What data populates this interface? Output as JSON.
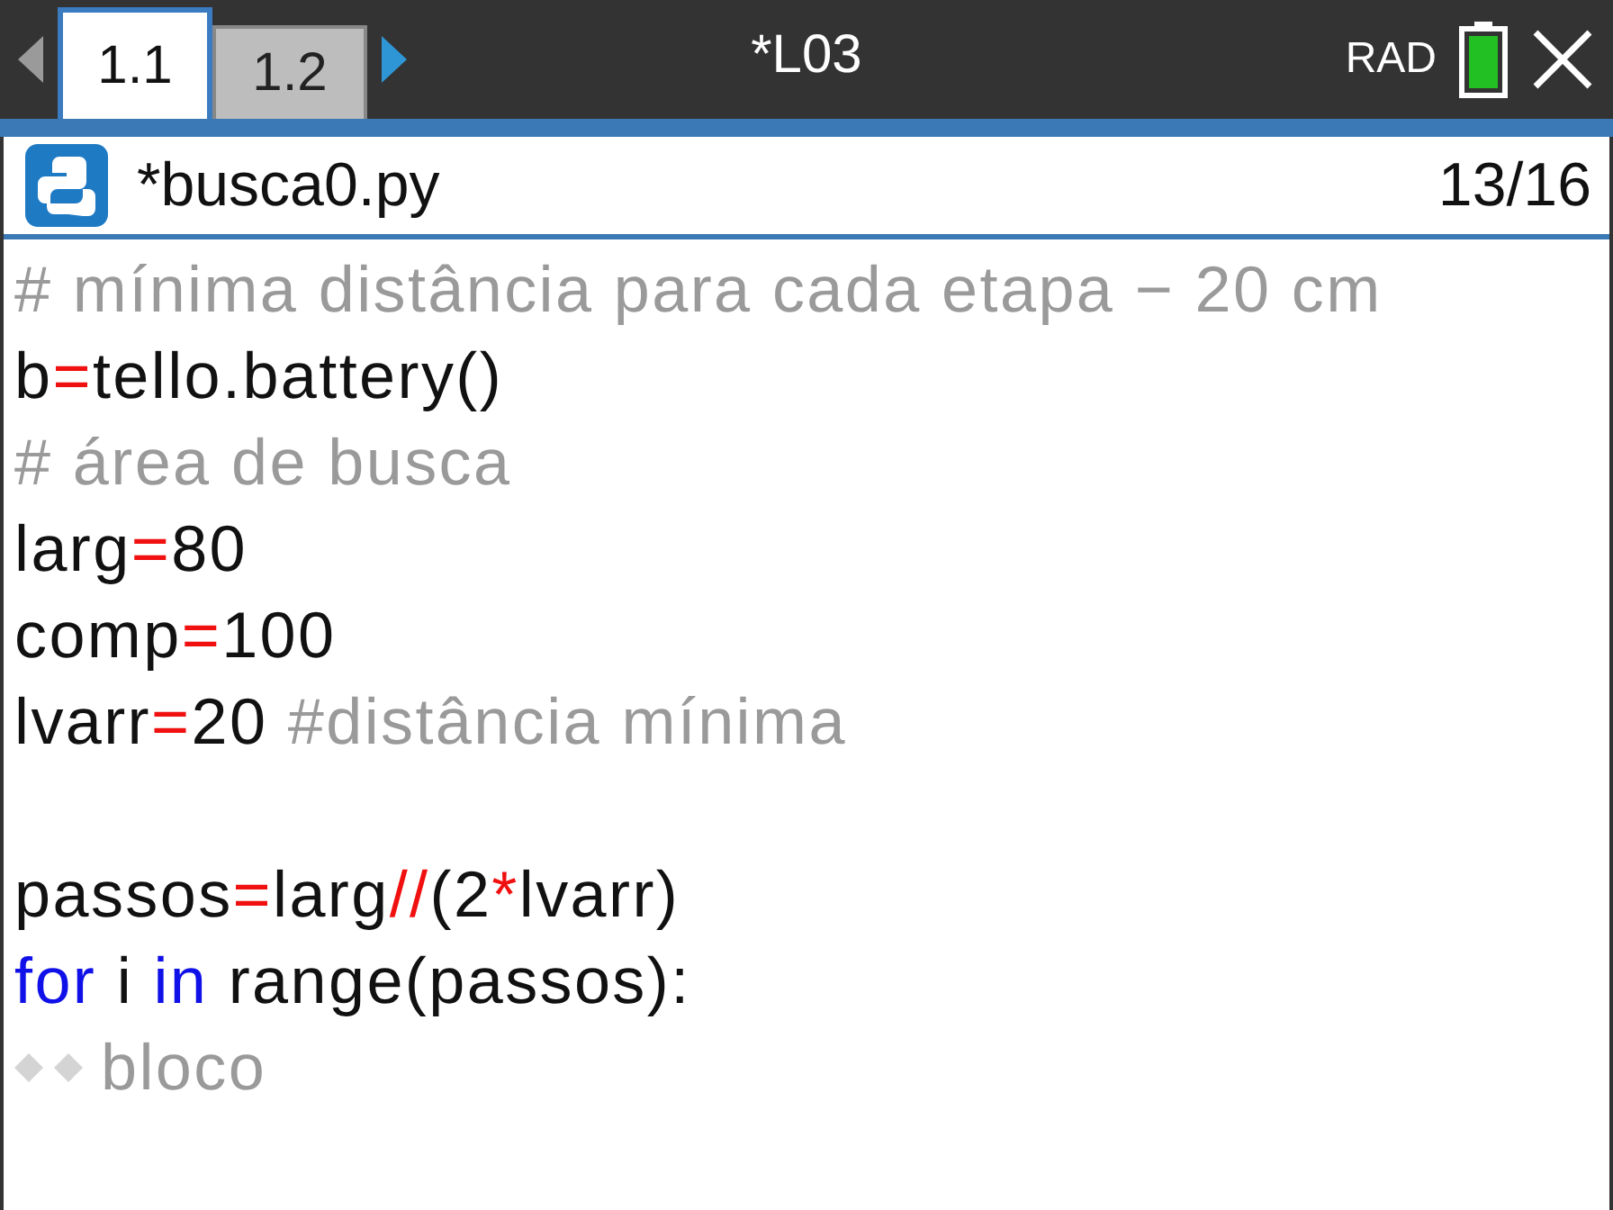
{
  "header": {
    "tabs": [
      {
        "label": "1.1",
        "selected": true
      },
      {
        "label": "1.2",
        "selected": false
      }
    ],
    "title": "*L03",
    "angle_mode": "RAD"
  },
  "file_bar": {
    "filename": "*busca0.py",
    "position": "13/16"
  },
  "editor": {
    "lines": [
      {
        "kind": "code",
        "indent": false,
        "tokens": [
          {
            "kind": "comment",
            "text": "# mínima distância para cada etapa − 20 cm"
          }
        ]
      },
      {
        "kind": "code",
        "indent": false,
        "tokens": [
          {
            "kind": "text",
            "text": "b"
          },
          {
            "kind": "op",
            "text": "="
          },
          {
            "kind": "text",
            "text": "tello.battery()"
          }
        ]
      },
      {
        "kind": "code",
        "indent": false,
        "tokens": [
          {
            "kind": "comment",
            "text": "# área de busca"
          }
        ]
      },
      {
        "kind": "code",
        "indent": false,
        "tokens": [
          {
            "kind": "text",
            "text": "larg"
          },
          {
            "kind": "op",
            "text": "="
          },
          {
            "kind": "text",
            "text": "80"
          }
        ]
      },
      {
        "kind": "code",
        "indent": false,
        "tokens": [
          {
            "kind": "text",
            "text": "comp"
          },
          {
            "kind": "op",
            "text": "="
          },
          {
            "kind": "text",
            "text": "100"
          }
        ]
      },
      {
        "kind": "code",
        "indent": false,
        "tokens": [
          {
            "kind": "text",
            "text": "lvarr"
          },
          {
            "kind": "op",
            "text": "="
          },
          {
            "kind": "text",
            "text": "20 "
          },
          {
            "kind": "comment",
            "text": "#distância mínima"
          }
        ]
      },
      {
        "kind": "blank"
      },
      {
        "kind": "code",
        "indent": false,
        "tokens": [
          {
            "kind": "text",
            "text": "passos"
          },
          {
            "kind": "op",
            "text": "="
          },
          {
            "kind": "text",
            "text": "larg"
          },
          {
            "kind": "op",
            "text": "//"
          },
          {
            "kind": "text",
            "text": "(2"
          },
          {
            "kind": "op",
            "text": "*"
          },
          {
            "kind": "text",
            "text": "lvarr)"
          }
        ]
      },
      {
        "kind": "code",
        "indent": false,
        "tokens": [
          {
            "kind": "kw",
            "text": "for"
          },
          {
            "kind": "text",
            "text": " i "
          },
          {
            "kind": "kw",
            "text": "in"
          },
          {
            "kind": "text",
            "text": " range(passos):"
          }
        ]
      },
      {
        "kind": "code",
        "indent": true,
        "tokens": [
          {
            "kind": "comment",
            "text": "bloco"
          }
        ]
      }
    ]
  }
}
